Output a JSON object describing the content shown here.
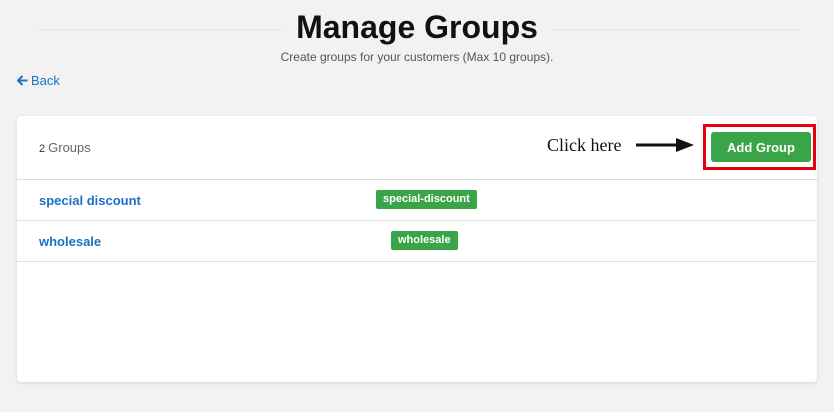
{
  "header": {
    "title": "Manage Groups",
    "subtitle": "Create groups for your customers (Max 10 groups)."
  },
  "nav": {
    "back_label": "Back",
    "back_icon": "arrow-left-icon"
  },
  "panel": {
    "group_count": "2",
    "group_count_label": "Groups",
    "add_button_label": "Add Group",
    "annotation_text": "Click here",
    "annotation_icon": "arrow-right-icon",
    "accent_color": "#3aa449",
    "highlight_color": "#e3000f",
    "link_color": "#1a72c4"
  },
  "groups": [
    {
      "name": "special discount",
      "tag": "special-discount"
    },
    {
      "name": "wholesale",
      "tag": "wholesale"
    }
  ]
}
